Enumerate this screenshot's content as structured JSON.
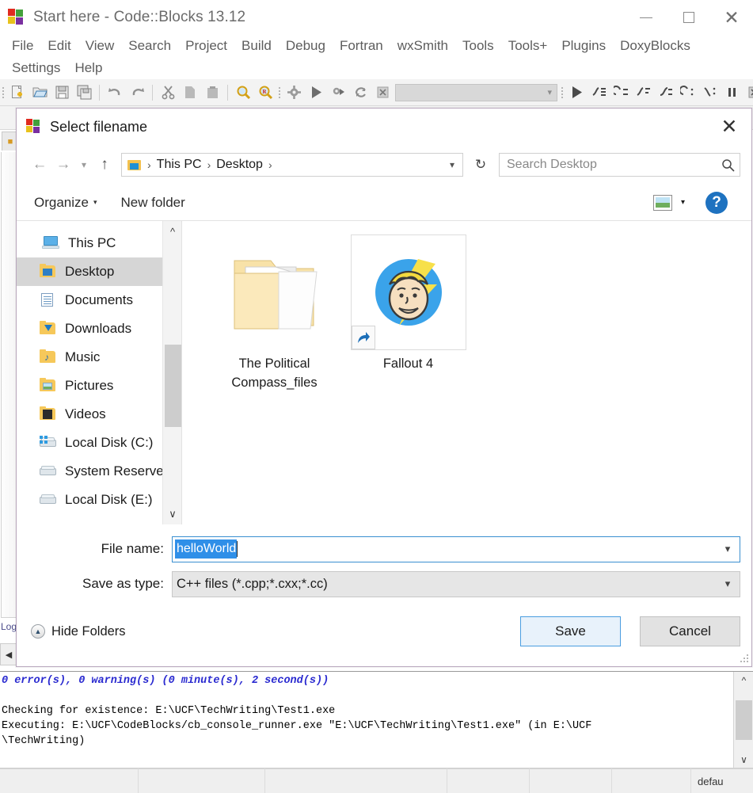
{
  "app": {
    "title": "Start here - Code::Blocks 13.12",
    "window_controls": {
      "minimize": "minimize-icon",
      "maximize": "maximize-icon",
      "close": "close-icon"
    },
    "menus_row1": [
      "File",
      "Edit",
      "View",
      "Search",
      "Project",
      "Build",
      "Debug",
      "Fortran",
      "wxSmith",
      "Tools",
      "Tools+",
      "Plugins",
      "DoxyBlocks"
    ],
    "menus_row2": [
      "Settings",
      "Help"
    ],
    "toolbar_icons_main": [
      "new-file-icon",
      "open-file-icon",
      "save-icon",
      "save-all-icon",
      "undo-icon",
      "redo-icon",
      "cut-icon",
      "copy-icon",
      "paste-icon",
      "find-icon",
      "replace-icon"
    ],
    "toolbar_icons_build": [
      "build-icon",
      "run-icon",
      "build-and-run-icon",
      "rebuild-icon",
      "abort-icon"
    ],
    "toolbar_target_value": "",
    "toolbar_icons_debug": [
      "debug-continue-icon",
      "debug-run-to-cursor-icon",
      "debug-next-line-icon",
      "debug-step-into-icon",
      "debug-step-out-icon",
      "debug-next-instruction-icon",
      "debug-step-into-instruction-icon",
      "debug-break-icon",
      "debug-stop-icon",
      "debugging-windows-icon"
    ],
    "logs_tab_label": "Logs",
    "log_scroll_left": "left-arrow-icon"
  },
  "dialog": {
    "title": "Select filename",
    "close_label": "✕",
    "nav": {
      "back": "back-arrow-icon",
      "forward": "forward-arrow-icon",
      "recent": "recent-locations-icon",
      "up": "up-arrow-icon",
      "breadcrumbs": [
        "This PC",
        "Desktop"
      ],
      "breadcrumb_separator": "›",
      "address_dropdown": "chevron-down-icon",
      "refresh": "refresh-icon",
      "search_placeholder": "Search Desktop",
      "search_value": "",
      "search_icon": "magnifier-icon"
    },
    "toolbar": {
      "organize": "Organize",
      "organize_caret": "▾",
      "new_folder": "New folder",
      "view_icon": "view-mode-icon",
      "view_caret": "▾",
      "help": "?"
    },
    "sidebar": {
      "items": [
        {
          "label": "This PC",
          "icon": "this-pc-icon",
          "selected": false,
          "root": true
        },
        {
          "label": "Desktop",
          "icon": "desktop-folder-icon",
          "selected": true,
          "root": false
        },
        {
          "label": "Documents",
          "icon": "documents-folder-icon",
          "selected": false,
          "root": false
        },
        {
          "label": "Downloads",
          "icon": "downloads-folder-icon",
          "selected": false,
          "root": false
        },
        {
          "label": "Music",
          "icon": "music-folder-icon",
          "selected": false,
          "root": false
        },
        {
          "label": "Pictures",
          "icon": "pictures-folder-icon",
          "selected": false,
          "root": false
        },
        {
          "label": "Videos",
          "icon": "videos-folder-icon",
          "selected": false,
          "root": false
        },
        {
          "label": "Local Disk (C:)",
          "icon": "windows-drive-icon",
          "selected": false,
          "root": false
        },
        {
          "label": "System Reserved",
          "icon": "drive-icon",
          "selected": false,
          "root": false
        },
        {
          "label": "Local Disk (E:)",
          "icon": "drive-icon",
          "selected": false,
          "root": false
        }
      ],
      "scroll_up": "chevron-up-icon",
      "scroll_down": "chevron-down-icon"
    },
    "files": [
      {
        "name_line1": "The Political",
        "name_line2": "Compass_files",
        "type": "folder",
        "shortcut": false
      },
      {
        "name_line1": "Fallout 4",
        "name_line2": "",
        "type": "shortcut",
        "shortcut": true
      }
    ],
    "fields": {
      "file_name_label": "File name:",
      "file_name_value": "helloWorld",
      "file_name_dropdown": "chevron-down-icon",
      "save_as_type_label": "Save as type:",
      "save_as_type_value": "C++ files (*.cpp;*.cxx;*.cc)",
      "save_as_type_dropdown": "chevron-down-icon"
    },
    "actions": {
      "hide_folders": "Hide Folders",
      "hide_folders_icon": "▲",
      "save": "Save",
      "cancel": "Cancel"
    }
  },
  "log": {
    "summary": "0 error(s), 0 warning(s) (0 minute(s), 2 second(s))",
    "blank": "",
    "line_check": "Checking for existence: E:\\UCF\\TechWriting\\Test1.exe",
    "line_exec": "Executing: E:\\UCF\\CodeBlocks/cb_console_runner.exe \"E:\\UCF\\TechWriting\\Test1.exe\" (in E:\\UCF",
    "line_exec2": "\\TechWriting)",
    "scroll_up": "chevron-up-icon",
    "scroll_down": "chevron-down-icon"
  },
  "statusbar": {
    "cells": [
      "",
      "",
      "",
      "",
      "",
      "",
      "defau"
    ]
  },
  "colors": {
    "accent_blue": "#2f8fe8",
    "save_border": "#4a9de0",
    "log_summary": "#2a2ad0",
    "selection_gray": "#d6d6d6"
  }
}
